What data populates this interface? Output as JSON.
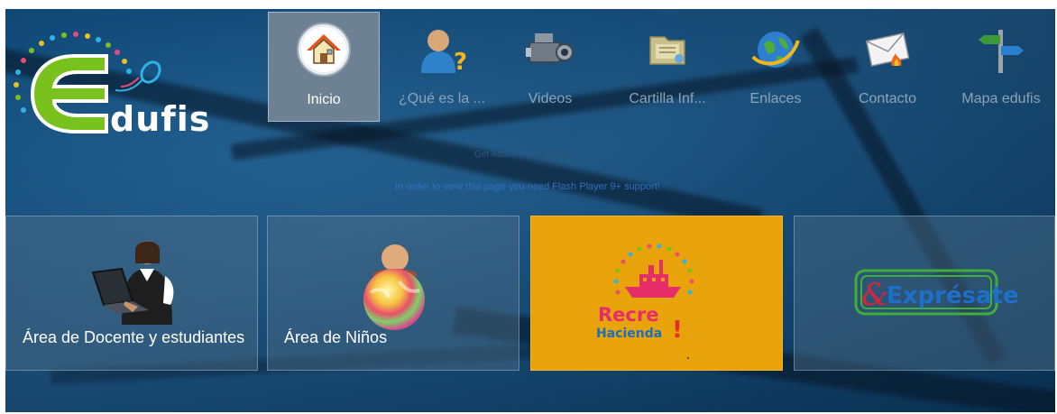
{
  "logo": {
    "text": "dufis"
  },
  "nav": {
    "items": [
      {
        "label": "Inicio",
        "icon": "house-icon",
        "active": true
      },
      {
        "label": "¿Qué es la ...",
        "icon": "user-question-icon",
        "active": false
      },
      {
        "label": "Videos",
        "icon": "video-camera-icon",
        "active": false
      },
      {
        "label": "Cartilla Inf...",
        "icon": "folder-icon",
        "active": false
      },
      {
        "label": "Enlaces",
        "icon": "globe-link-icon",
        "active": false
      },
      {
        "label": "Contacto",
        "icon": "envelope-icon",
        "active": false
      },
      {
        "label": "Mapa edufis",
        "icon": "signpost-icon",
        "active": false
      }
    ]
  },
  "flash": {
    "title": "Get Adobe Flash player",
    "message": "In order to view this page you need Flash Player 9+ support!"
  },
  "tiles": [
    {
      "label": "Área de Docente y estudiantes"
    },
    {
      "label": "Área de Niños"
    },
    {
      "line1": "Recre",
      "line2": "Hacienda",
      "mark": "!"
    },
    {
      "label": "Exprésate"
    }
  ],
  "colors": {
    "background": "#0f4775",
    "nav_active": "#6d8193",
    "recre_tile": "#e8a20a",
    "logo_green": "#79c21e"
  }
}
